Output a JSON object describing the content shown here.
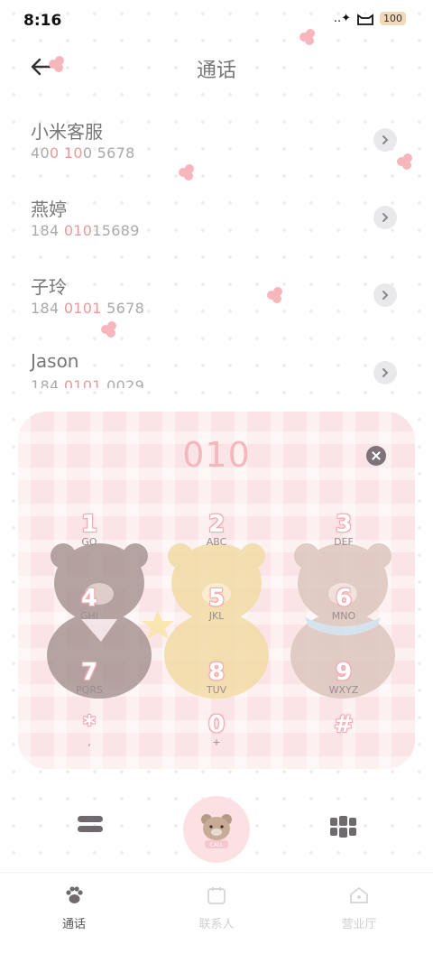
{
  "status": {
    "time": "8:16",
    "signal": "..✦",
    "battery": "100"
  },
  "header": {
    "title": "通话"
  },
  "contacts": [
    {
      "name": "小米客服",
      "number_parts": [
        "40",
        "0",
        " ",
        "10",
        "0 5678"
      ]
    },
    {
      "name": "燕婷",
      "number_parts": [
        "184 ",
        "010",
        "15689"
      ]
    },
    {
      "name": "子玲",
      "number_parts": [
        "184 ",
        "0101",
        " 5678"
      ]
    },
    {
      "name": "Jason",
      "number_parts": [
        "184 ",
        "0101",
        " 0029"
      ]
    }
  ],
  "dialpad": {
    "dialed": "010",
    "keys": [
      {
        "digit": "1",
        "letters": "GO"
      },
      {
        "digit": "2",
        "letters": "ABC"
      },
      {
        "digit": "3",
        "letters": "DEF"
      },
      {
        "digit": "4",
        "letters": "GHI"
      },
      {
        "digit": "5",
        "letters": "JKL"
      },
      {
        "digit": "6",
        "letters": "MNO"
      },
      {
        "digit": "7",
        "letters": "PQRS"
      },
      {
        "digit": "8",
        "letters": "TUV"
      },
      {
        "digit": "9",
        "letters": "WXYZ"
      },
      {
        "digit": "*",
        "letters": ","
      },
      {
        "digit": "0",
        "letters": "+"
      },
      {
        "digit": "#",
        "letters": ""
      }
    ]
  },
  "call_button": {
    "badge": "CALL"
  },
  "nav": [
    {
      "label": "通话",
      "icon": "paw-icon"
    },
    {
      "label": "联系人",
      "icon": "calendar-icon"
    },
    {
      "label": "营业厅",
      "icon": "house-icon"
    }
  ],
  "colors": {
    "accent": "#f4aab2",
    "highlight": "#e99a9a",
    "pad_bg": "#fbe4e6"
  }
}
